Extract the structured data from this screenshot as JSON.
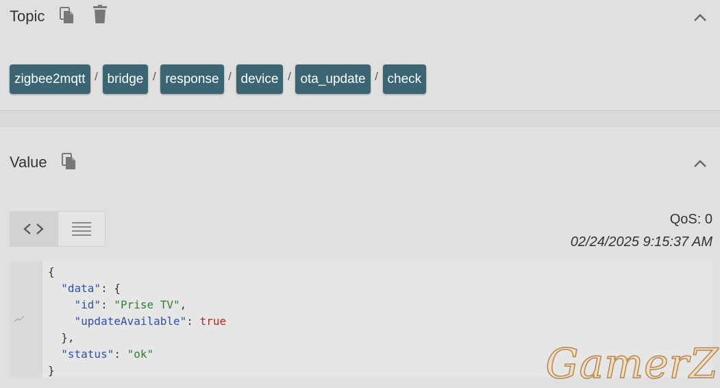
{
  "topic": {
    "title": "Topic",
    "segments": [
      "zigbee2mqtt",
      "bridge",
      "response",
      "device",
      "ota_update",
      "check"
    ],
    "separator": "/"
  },
  "value": {
    "title": "Value",
    "qos": "QoS: 0",
    "timestamp": "02/24/2025 9:15:37 AM",
    "view_modes": [
      "code-view",
      "list-view"
    ],
    "active_view": "code-view",
    "code_lines": [
      "{",
      "  \"data\": {",
      "    \"id\": \"Prise TV\",",
      "    \"updateAvailable\": true",
      "  },",
      "  \"status\": \"ok\"",
      "}"
    ]
  },
  "icons": {
    "copy": "copy-icon",
    "delete": "trash-icon",
    "collapse": "chevron-up-icon"
  },
  "watermark": "GamerZ",
  "colors": {
    "chip_bg": "#3b6573",
    "chip_text": "#ffffff",
    "json_key": "#2f4fa8",
    "json_string": "#2e7d32",
    "json_boolean": "#a0301f"
  }
}
